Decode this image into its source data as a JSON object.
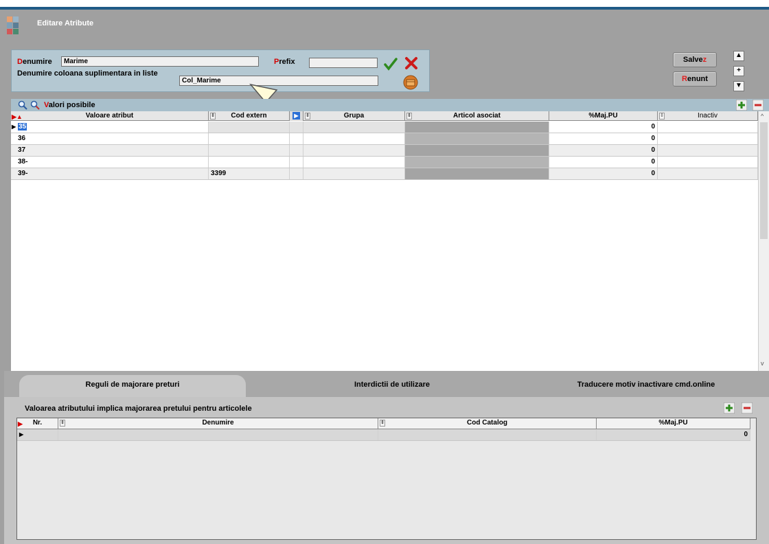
{
  "window": {
    "title": "Editare Atribute"
  },
  "header": {
    "denumire_label_first": "D",
    "denumire_label_rest": "enumire",
    "denumire_value": "Marime",
    "prefix_label_first": "P",
    "prefix_label_rest": "refix",
    "prefix_value": "",
    "col_label": "Denumire coloana suplimentara in liste",
    "col_value": "Col_Marime"
  },
  "buttons": {
    "save_main": "Salve",
    "save_hot": "z",
    "cancel_hot": "R",
    "cancel_main": "enunt",
    "up": "▲",
    "plus": "+",
    "down": "▼"
  },
  "grid": {
    "title_hot": "V",
    "title_rest": "alori posibile",
    "columns": [
      "Valoare atribut",
      "Cod extern",
      "Grupa",
      "Articol asociat",
      "%Maj.PU",
      "Inactiv"
    ],
    "rows": [
      {
        "valoare": "35",
        "cod": "",
        "grupa": "",
        "articol": "",
        "maj": "0",
        "inactiv": ""
      },
      {
        "valoare": "36",
        "cod": "",
        "grupa": "",
        "articol": "",
        "maj": "0",
        "inactiv": ""
      },
      {
        "valoare": "37",
        "cod": "",
        "grupa": "",
        "articol": "",
        "maj": "0",
        "inactiv": ""
      },
      {
        "valoare": "38-",
        "cod": "",
        "grupa": "",
        "articol": "",
        "maj": "0",
        "inactiv": ""
      },
      {
        "valoare": "39-",
        "cod": "3399",
        "grupa": "",
        "articol": "",
        "maj": "0",
        "inactiv": ""
      }
    ]
  },
  "tabs": [
    {
      "label": "Reguli de majorare preturi"
    },
    {
      "label": "Interdictii de utilizare"
    },
    {
      "label": "Traducere motiv inactivare cmd.online"
    }
  ],
  "bottom": {
    "title": "Valoarea atributului implica majorarea pretului pentru articolele",
    "columns": [
      "Nr.",
      "Denumire",
      "Cod Catalog",
      "%Maj.PU"
    ],
    "row": {
      "nr": "",
      "denumire": "",
      "cod": "",
      "maj": "0"
    }
  },
  "colors": {
    "title_bar": "#1f5a86",
    "panel": "#b4c8d2",
    "accent_red": "#d40000",
    "selected_cell": "#2a6fd6"
  }
}
